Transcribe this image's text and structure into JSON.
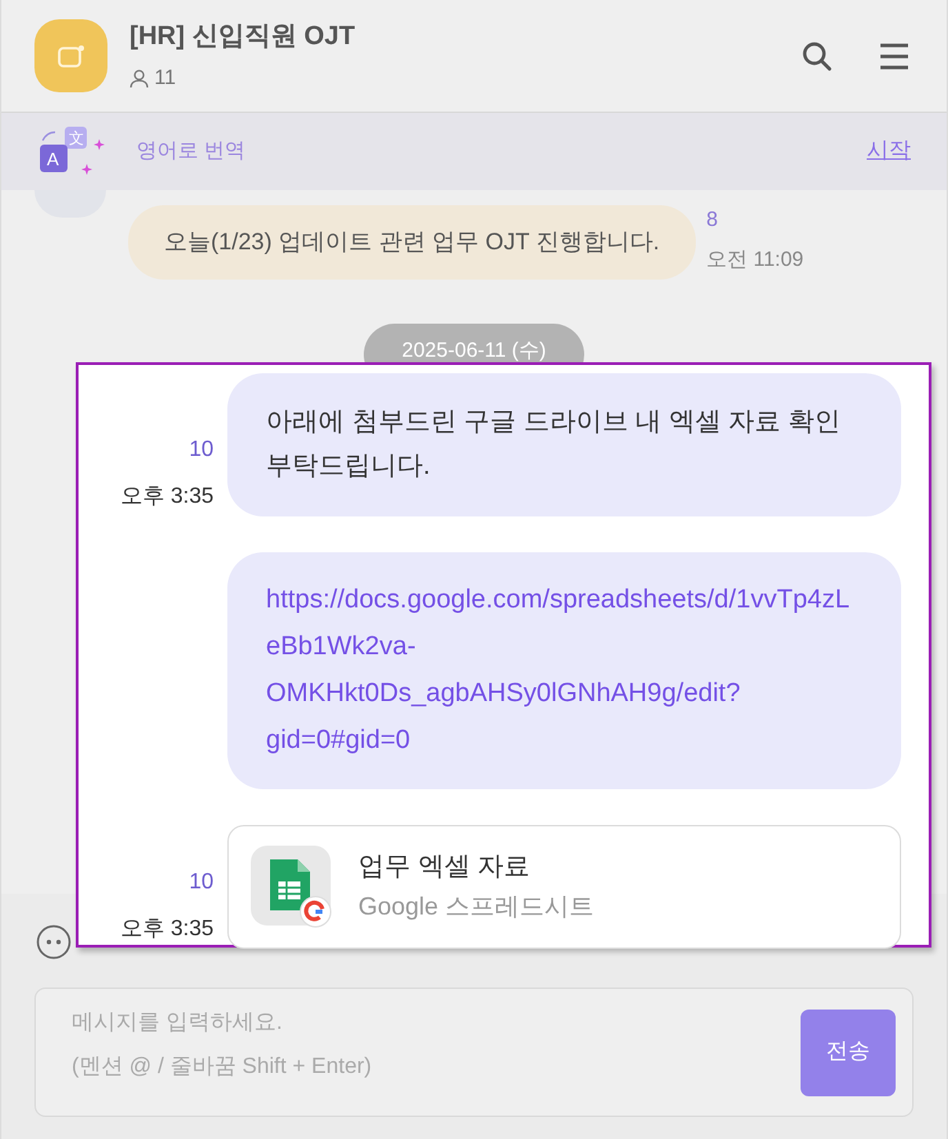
{
  "header": {
    "title": "[HR] 신입직원 OJT",
    "member_count": "11"
  },
  "translate_bar": {
    "icon_glyphs": [
      "文",
      "A"
    ],
    "label": "영어로 번역",
    "action": "시작"
  },
  "messages": [
    {
      "kind": "text",
      "text": "오늘(1/23) 업데이트 관련 업무 OJT 진행합니다.",
      "unread": "8",
      "time": "오전 11:09"
    }
  ],
  "date_divider": "2025-06-11 (수)",
  "highlighted_messages": [
    {
      "kind": "text",
      "text": "아래에 첨부드린 구글 드라이브 내 엑셀 자료 확인 부탁드립니다.",
      "unread": "10",
      "time": "오후 3:35"
    },
    {
      "kind": "link",
      "text": "https://docs.google.com/spreadsheets/d/1vvTp4zLeBb1Wk2va-OMKHkt0Ds_agbAHSy0lGNhAH9g/edit?gid=0#gid=0"
    },
    {
      "kind": "file",
      "title": "업무 엑셀 자료",
      "subtitle": "Google 스프레드시트",
      "unread": "10",
      "time": "오후 3:35"
    }
  ],
  "composer": {
    "placeholder": "메시지를 입력하세요.\n(멘션 @ / 줄바꿈 Shift + Enter)",
    "send": "전송"
  }
}
